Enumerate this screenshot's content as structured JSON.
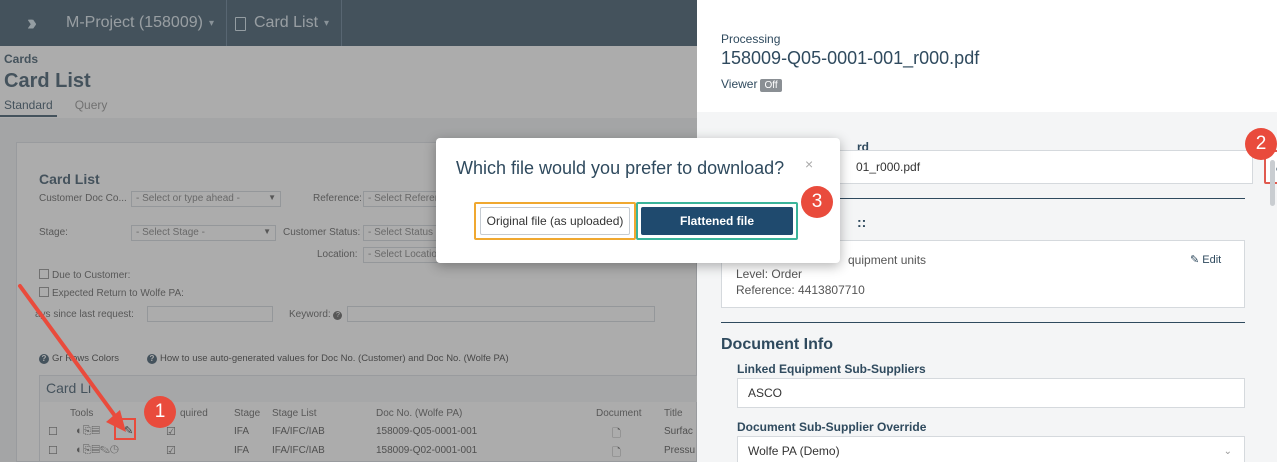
{
  "topbar": {
    "project": "M-Project (158009)",
    "section": "Card List"
  },
  "page": {
    "small_title": "Cards",
    "title": "Card List",
    "tabs": [
      "Standard",
      "Query"
    ]
  },
  "filters": {
    "heading": "Card List",
    "customer_doc_label": "Customer Doc Co...",
    "customer_doc_placeholder": "- Select or type ahead -",
    "reference_label": "Reference:",
    "reference_placeholder": "- Select Referen",
    "stage_label": "Stage:",
    "stage_placeholder": "- Select Stage -",
    "customer_status_label": "Customer Status:",
    "customer_status_placeholder": "- Select Status -",
    "location_label": "Location:",
    "location_placeholder": "- Select Locatio",
    "due_label": "Due to Customer:",
    "expected_label": "Expected Return to Wolfe PA:",
    "days_label": "ays since last request:",
    "keyword_label": "Keyword:",
    "grid_colors": "Gr    Rows Colors",
    "how_to": "How to use auto-generated values for Doc No. (Customer) and Doc No. (Wolfe PA)"
  },
  "table": {
    "caption": "Card Li",
    "headers": [
      "Tools",
      "quired",
      "Stage",
      "Stage List",
      "Doc No. (Wolfe PA)",
      "Document",
      "Title"
    ],
    "rows": [
      {
        "stage": "IFA",
        "stage_list": "IFA/IFC/IAB",
        "doc_no": "158009-Q05-0001-001",
        "title": "Surfac"
      },
      {
        "stage": "IFA",
        "stage_list": "IFA/IFC/IAB",
        "doc_no": "158009-Q02-0001-001",
        "title": "Pressu"
      }
    ]
  },
  "modal": {
    "title": "Which file would you prefer to download?",
    "close": "×",
    "original_label": "Original file (as uploaded)",
    "flattened_label": "Flattened file"
  },
  "panel": {
    "processing": "Processing",
    "filename": "158009-Q05-0001-001_r000.pdf",
    "viewer_label": "Viewer",
    "viewer_state": "Off",
    "card_label": "rd",
    "card_file": "01_r000.pdf",
    "section_colon": "::",
    "equipment": "quipment units",
    "edit": "Edit",
    "level": "Level: Order",
    "reference": "Reference: 4413807710",
    "doc_info": "Document Info",
    "linked_label": "Linked Equipment Sub-Suppliers",
    "linked_value": "ASCO",
    "override_label": "Document Sub-Supplier Override",
    "override_value": "Wolfe PA (Demo)"
  },
  "steps": [
    "1",
    "2",
    "3"
  ],
  "colors": {
    "brand": "#2f4a5e",
    "primary_button": "#1f4a6e",
    "step_marker": "#e94b3c",
    "highlight_orange": "#f0a830",
    "highlight_teal": "#3bb49a"
  }
}
